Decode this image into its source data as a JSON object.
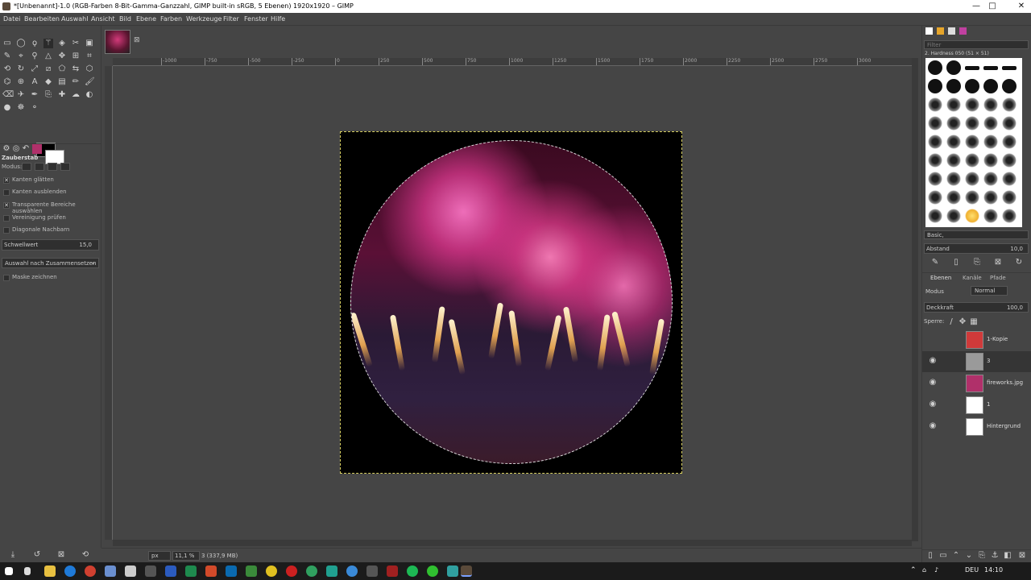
{
  "window": {
    "title": "*[Unbenannt]-1.0 (RGB-Farben 8-Bit-Gamma-Ganzzahl, GIMP built-in sRGB, 5 Ebenen) 1920x1920 – GIMP",
    "minimize": "—",
    "maximize": "□",
    "close": "✕"
  },
  "menu": [
    "Datei",
    "Bearbeiten",
    "Auswahl",
    "Ansicht",
    "Bild",
    "Ebene",
    "Farben",
    "Werkzeuge",
    "Filter",
    "Fenster",
    "Hilfe"
  ],
  "tool_options": {
    "title": "Zauberstab",
    "mode_label": "Modus:",
    "options": [
      {
        "label": "Kanten glätten",
        "checked": true
      },
      {
        "label": "Kanten ausblenden",
        "checked": false
      },
      {
        "label": "Transparente Bereiche auswählen",
        "checked": true
      },
      {
        "label": "Vereinigung prüfen",
        "checked": false
      },
      {
        "label": "Diagonale Nachbarn",
        "checked": false
      }
    ],
    "threshold_label": "Schwellwert",
    "threshold_value": "15,0",
    "select_by": "Auswahl nach Zusammensetzen",
    "draw_mask": "Maske zeichnen"
  },
  "ruler_top": [
    "-1000",
    "-750",
    "-500",
    "-250",
    "0",
    "250",
    "500",
    "750",
    "1000",
    "1250",
    "1500",
    "1750",
    "2000",
    "2250",
    "2500",
    "2750",
    "3000"
  ],
  "statusbar": {
    "unit": "px",
    "zoom": "11,1 %",
    "info": "3 (337,9 MB)"
  },
  "brushes": {
    "filter_placeholder": "Filter",
    "current": "2. Hardness 050 (51 × 51)",
    "preset": "Basic,",
    "spacing_label": "Abstand",
    "spacing_value": "10,0"
  },
  "layers_panel": {
    "tabs": [
      "Ebenen",
      "Kanäle",
      "Pfade"
    ],
    "mode_label": "Modus",
    "mode_value": "Normal",
    "opacity_label": "Deckkraft",
    "opacity_value": "100,0",
    "lock_label": "Sperre:",
    "layers": [
      {
        "name": "1-Kopie",
        "visible": false,
        "thumb": "#d03a3a",
        "active": false
      },
      {
        "name": "3",
        "visible": true,
        "thumb": "#9a9a9a",
        "active": true
      },
      {
        "name": "fireworks.jpg",
        "visible": true,
        "thumb": "#b0306a",
        "active": false
      },
      {
        "name": "1",
        "visible": true,
        "thumb": "#ffffff",
        "active": false
      },
      {
        "name": "Hintergrund",
        "visible": true,
        "thumb": "#ffffff",
        "active": false
      }
    ]
  },
  "taskbar": {
    "language": "DEU",
    "time": "14:10"
  },
  "colors": {
    "ui_bg": "#454545",
    "selection": "#d8d060",
    "taskbar": "#1b1b1b"
  }
}
